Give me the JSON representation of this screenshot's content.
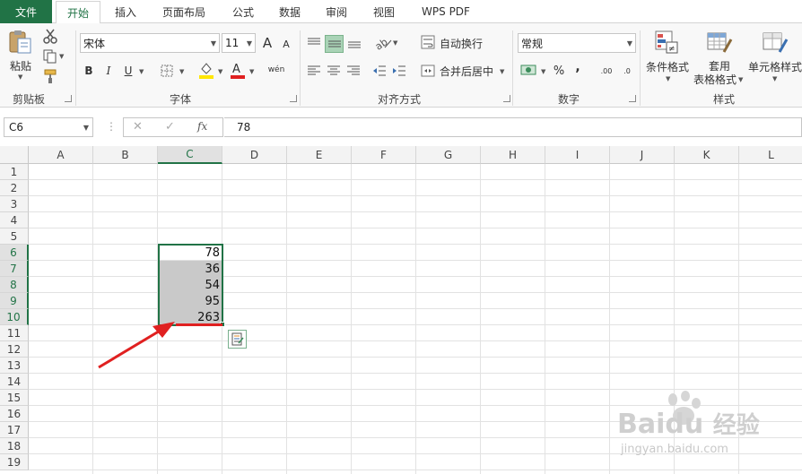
{
  "tabs": {
    "file": "文件",
    "items": [
      "开始",
      "插入",
      "页面布局",
      "公式",
      "数据",
      "审阅",
      "视图",
      "WPS PDF"
    ],
    "active_index": 0
  },
  "ribbon": {
    "clipboard": {
      "paste_label": "粘贴",
      "group_label": "剪贴板"
    },
    "font": {
      "font_name": "宋体",
      "font_size": "11",
      "bold": "B",
      "italic": "I",
      "underline": "U",
      "grow": "A",
      "shrink": "A",
      "phonetic": "wén",
      "group_label": "字体"
    },
    "alignment": {
      "wrap_label": "自动换行",
      "merge_label": "合并后居中",
      "group_label": "对齐方式"
    },
    "number": {
      "format_value": "常规",
      "percent": "%",
      "comma": ",",
      "increase_decimal": ".00",
      "decrease_decimal": ".0",
      "group_label": "数字"
    },
    "styles": {
      "conditional_label": "条件格式",
      "table_label_1": "套用",
      "table_label_2": "表格格式",
      "cell_style_label": "单元格样式",
      "group_label": "样式"
    }
  },
  "formula_bar": {
    "name_box": "C6",
    "cancel": "✕",
    "enter": "✓",
    "fx": "fx",
    "content": "78"
  },
  "sheet": {
    "columns": [
      "A",
      "B",
      "C",
      "D",
      "E",
      "F",
      "G",
      "H",
      "I",
      "J",
      "K",
      "L"
    ],
    "rows": [
      "1",
      "2",
      "3",
      "4",
      "5",
      "6",
      "7",
      "8",
      "9",
      "10",
      "11",
      "12",
      "13",
      "14",
      "15",
      "16",
      "17",
      "18",
      "19"
    ],
    "selected_column": "C",
    "selected_rows": [
      "6",
      "7",
      "8",
      "9",
      "10"
    ],
    "cells": [
      {
        "ref": "C6",
        "value": "78"
      },
      {
        "ref": "C7",
        "value": "36"
      },
      {
        "ref": "C8",
        "value": "54"
      },
      {
        "ref": "C9",
        "value": "95"
      },
      {
        "ref": "C10",
        "value": "263"
      }
    ]
  },
  "watermark": {
    "brand": "Bai",
    "brand2": "du",
    "cn": "经验",
    "url": "jingyan.baidu.com"
  },
  "colors": {
    "accent": "#217346",
    "arrow": "#e02020",
    "selection_fill": "#c9c9c9"
  }
}
